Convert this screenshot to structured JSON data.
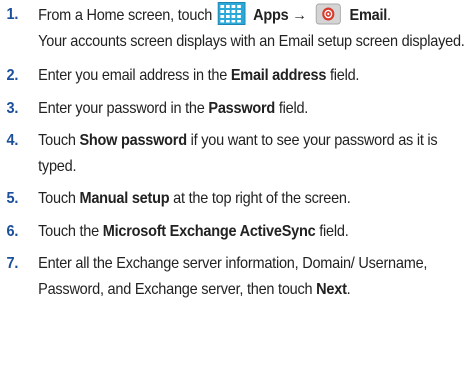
{
  "steps": [
    {
      "num": "1.",
      "t1": "From a Home screen, touch",
      "apps_label": "Apps",
      "arrow": "→",
      "email_label": "Email",
      "t2": ".",
      "t3": "Your accounts screen displays with an Email setup screen displayed."
    },
    {
      "num": "2.",
      "t1": "Enter you email address in the ",
      "b1": "Email address",
      "t2": " field."
    },
    {
      "num": "3.",
      "t1": "Enter your password in the ",
      "b1": "Password",
      "t2": " field."
    },
    {
      "num": "4.",
      "t1": "Touch ",
      "b1": "Show password",
      "t2": " if you want to see your password as it is typed."
    },
    {
      "num": "5.",
      "t1": "Touch ",
      "b1": "Manual setup",
      "t2": " at the top right of the screen."
    },
    {
      "num": "6.",
      "t1": "Touch the ",
      "b1": "Microsoft Exchange ActiveSync",
      "t2": " field."
    },
    {
      "num": "7.",
      "t1": "Enter all the Exchange server information, Domain/ Username, Password, and Exchange server, then touch ",
      "b1": "Next",
      "t2": "."
    }
  ],
  "icons": {
    "apps": "apps-grid-icon",
    "email": "email-app-icon"
  },
  "colors": {
    "number": "#1a4f9c",
    "apps_icon": "#2aa8d8",
    "email_icon_bg": "#c8c8c8",
    "email_icon_accent": "#d9392b"
  }
}
